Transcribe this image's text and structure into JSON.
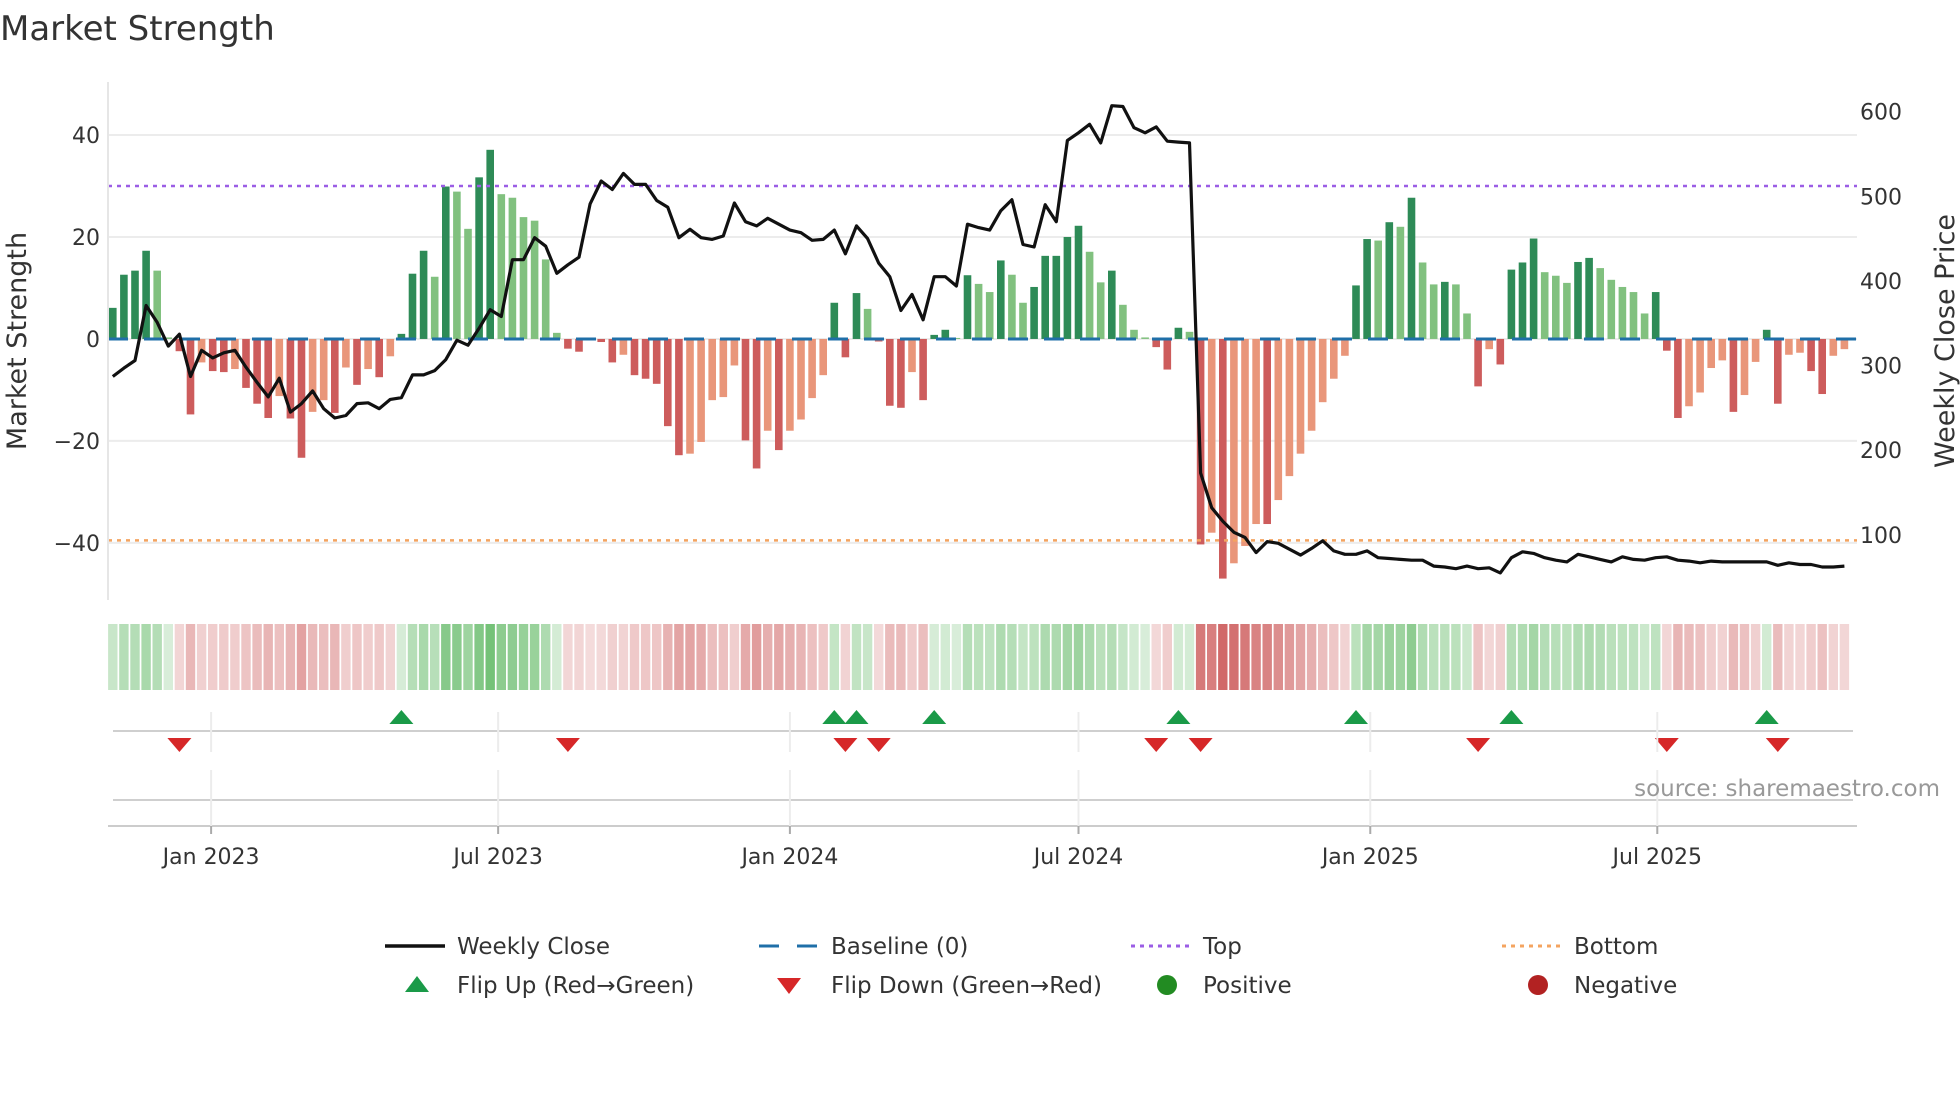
{
  "chart_data": {
    "type": "bar",
    "title": "Market Strength",
    "ylabel": "Market Strength",
    "y2label": "Weekly Close Price",
    "ylim": [
      -51.2,
      50.4
    ],
    "y2lim": [
      23,
      635
    ],
    "yticks": [
      {
        "v": -40,
        "label": "−40"
      },
      {
        "v": -20,
        "label": "−20"
      },
      {
        "v": 0,
        "label": "0"
      },
      {
        "v": 20,
        "label": "20"
      },
      {
        "v": 40,
        "label": "40"
      }
    ],
    "y2ticks": [
      {
        "v": 100,
        "label": "100"
      },
      {
        "v": 200,
        "label": "200"
      },
      {
        "v": 300,
        "label": "300"
      },
      {
        "v": 400,
        "label": "400"
      },
      {
        "v": 500,
        "label": "500"
      },
      {
        "v": 600,
        "label": "600"
      }
    ],
    "start_date": "2022-10-31",
    "frequency": "weekly",
    "x_ticks": [
      {
        "label": "Jan 2023",
        "date": "2023-01-01"
      },
      {
        "label": "Jul 2023",
        "date": "2023-07-01"
      },
      {
        "label": "Jan 2024",
        "date": "2024-01-01"
      },
      {
        "label": "Jul 2024",
        "date": "2024-07-01"
      },
      {
        "label": "Jan 2025",
        "date": "2025-01-01"
      },
      {
        "label": "Jul 2025",
        "date": "2025-07-01"
      }
    ],
    "top_level": 30,
    "bottom_level": -39.5,
    "series": [
      {
        "name": "Market Strength",
        "axis": "left",
        "values": [
          6.1,
          12.6,
          13.4,
          17.3,
          13.4,
          0.3,
          -2.4,
          -14.8,
          -4.6,
          -6.3,
          -6.5,
          -5.9,
          -9.6,
          -12.7,
          -15.5,
          -11.2,
          -15.6,
          -23.3,
          -14.3,
          -12,
          -14.5,
          -5.6,
          -9.0,
          -5.9,
          -7.5,
          -3.4,
          1.0,
          12.8,
          17.3,
          12.2,
          29.9,
          28.9,
          21.6,
          31.7,
          37.1,
          28.4,
          27.7,
          23.9,
          23.2,
          15.6,
          1.2,
          -1.9,
          -2.5,
          -0.3,
          -0.6,
          -4.6,
          -3.1,
          -7.1,
          -7.8,
          -8.8,
          -17.1,
          -22.8,
          -22.5,
          -20.2,
          -12,
          -11.4,
          -5.2,
          -19.9,
          -25.4,
          -18,
          -21.8,
          -18,
          -15.8,
          -11.6,
          -7.1,
          7.1,
          -3.6,
          9,
          5.9,
          -0.5,
          -13.1,
          -13.5,
          -6.5,
          -12,
          0.8,
          1.8,
          0.2,
          12.5,
          10.8,
          9.2,
          15.4,
          12.6,
          7.1,
          10.2,
          16.3,
          16.3,
          20,
          22.2,
          17.1,
          11.1,
          13.4,
          6.7,
          1.8,
          0.3,
          -1.6,
          -6,
          2.2,
          1.4,
          -40.3,
          -38,
          -47,
          -44,
          -40.6,
          -36.3,
          -36.3,
          -31.6,
          -26.9,
          -22.5,
          -18,
          -12.4,
          -7.8,
          -3.3,
          10.5,
          19.6,
          19.3,
          22.9,
          22,
          27.7,
          15,
          10.7,
          11.2,
          10.7,
          5,
          -9.3,
          -2,
          -5,
          13.6,
          15,
          19.7,
          13.1,
          12.4,
          11,
          15.1,
          15.9,
          13.9,
          11.6,
          10.2,
          9.2,
          5,
          9.2,
          -2.3,
          -15.5,
          -13.2,
          -10.5,
          -5.7,
          -4.2,
          -14.3,
          -11,
          -4.5,
          1.8,
          -12.7,
          -3.1,
          -2.7,
          -6.3,
          -10.8,
          -3.3,
          -2
        ]
      },
      {
        "name": "Weekly Close",
        "axis": "right",
        "values": [
          287,
          297,
          306,
          371,
          351,
          323,
          337,
          287,
          318,
          309,
          315,
          318,
          298,
          280,
          263,
          285,
          245,
          255,
          270,
          249,
          238,
          241,
          255,
          256,
          249,
          260,
          262,
          289,
          289,
          294,
          307,
          330,
          324,
          344,
          366,
          358,
          425,
          425,
          451,
          441,
          409,
          419,
          428,
          491,
          518,
          508,
          527,
          514,
          514,
          495,
          487,
          451,
          461,
          451,
          449,
          453,
          492,
          470,
          465,
          474,
          467,
          460,
          457,
          448,
          449,
          460,
          432,
          465,
          450,
          421,
          405,
          365,
          384,
          354,
          405,
          405,
          394,
          467,
          463,
          460,
          483,
          496,
          443,
          440,
          490,
          470,
          566,
          575,
          585,
          563,
          607,
          606,
          581,
          575,
          582,
          565,
          564,
          563,
          173,
          132,
          116,
          103,
          97,
          79,
          92,
          90,
          83,
          76,
          84,
          93,
          81,
          77,
          77,
          81,
          73,
          72,
          71,
          70,
          70,
          63,
          62,
          60,
          63,
          60,
          61,
          55,
          73,
          80,
          78,
          73,
          70,
          68,
          77,
          74,
          71,
          68,
          74,
          71,
          70,
          73,
          74,
          70,
          69,
          67,
          69,
          68,
          68,
          68,
          68,
          68,
          64,
          67,
          65,
          65,
          62,
          62,
          63
        ]
      }
    ],
    "flip_up_weeks": [
      27,
      66,
      68,
      75,
      97,
      113,
      127,
      150
    ],
    "flip_down_weeks": [
      7,
      42,
      67,
      70,
      95,
      99,
      124,
      141,
      151
    ],
    "legend": {
      "placement": "bottom",
      "items": [
        {
          "label": "Weekly Close",
          "kind": "line"
        },
        {
          "label": "Baseline (0)",
          "kind": "dash"
        },
        {
          "label": "Top",
          "kind": "dot-top"
        },
        {
          "label": "Bottom",
          "kind": "dot-bottom"
        },
        {
          "label": "Flip Up (Red→Green)",
          "kind": "tri-up"
        },
        {
          "label": "Flip Down (Green→Red)",
          "kind": "tri-down"
        },
        {
          "label": "Positive",
          "kind": "dot-pos"
        },
        {
          "label": "Negative",
          "kind": "dot-neg"
        }
      ]
    },
    "source": "source: sharemaestro.com",
    "colors": {
      "pos_strong": "#2e8b57",
      "pos_weak": "#81c17f",
      "neg_strong": "#cd5c5c",
      "neg_weak": "#e9967a",
      "baseline": "#1f6fa8",
      "top": "#9b5de5",
      "bottom": "#f4a460",
      "price": "#111111",
      "flip_up": "#1a9a48",
      "flip_down": "#d62728",
      "positive": "#228b22",
      "negative": "#b22222",
      "strip_pos": "76,175,80",
      "strip_neg": "205,92,92"
    }
  }
}
